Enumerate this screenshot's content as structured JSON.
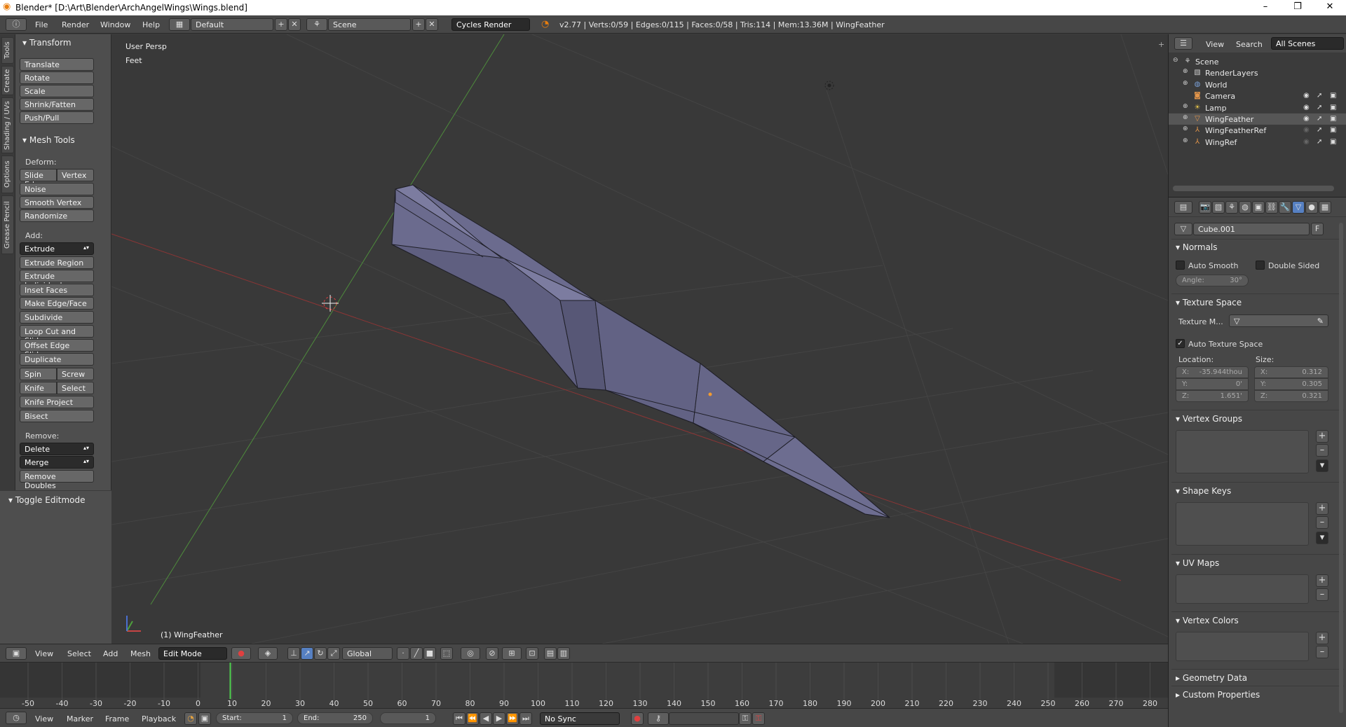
{
  "title_bar": {
    "title": "Blender* [D:\\Art\\Blender\\ArchAngelWings\\Wings.blend]",
    "minimize": "–",
    "maximize": "❐",
    "close": "✕"
  },
  "top_menu": {
    "items": [
      "File",
      "Render",
      "Window",
      "Help"
    ],
    "layout": "Default",
    "scene": "Scene",
    "engine": "Cycles Render",
    "stats": "v2.77 | Verts:0/59 | Edges:0/115 | Faces:0/58 | Tris:114 | Mem:13.36M | WingFeather"
  },
  "tool_tabs": [
    "Tools",
    "Create",
    "Shading / UVs",
    "Options",
    "Grease Pencil"
  ],
  "toolshelf": {
    "transform_header": "Transform",
    "transform": [
      "Translate",
      "Rotate",
      "Scale",
      "Shrink/Fatten",
      "Push/Pull"
    ],
    "mesh_tools_header": "Mesh Tools",
    "deform_label": "Deform:",
    "slide_edge": "Slide Ed",
    "vertex": "Vertex",
    "deform": [
      "Noise",
      "Smooth Vertex",
      "Randomize"
    ],
    "add_label": "Add:",
    "extrude": "Extrude",
    "add": [
      "Extrude Region",
      "Extrude Individual",
      "Inset Faces",
      "Make Edge/Face",
      "Subdivide",
      "Loop Cut and Slide",
      "Offset Edge Slide",
      "Duplicate"
    ],
    "spin": "Spin",
    "screw": "Screw",
    "knife": "Knife",
    "select": "Select",
    "add2": [
      "Knife Project",
      "Bisect"
    ],
    "remove_label": "Remove:",
    "delete": "Delete",
    "merge": "Merge",
    "remove_doubles": "Remove Doubles",
    "toggle_editmode": "Toggle Editmode"
  },
  "viewport": {
    "view_name": "User Persp",
    "units": "Feet",
    "object_label": "(1) WingFeather"
  },
  "view3d_header": {
    "menus": [
      "View",
      "Select",
      "Add",
      "Mesh"
    ],
    "mode": "Edit Mode",
    "orientation": "Global"
  },
  "timeline": {
    "ticks": [
      "-50",
      "-40",
      "-30",
      "-20",
      "-10",
      "0",
      "10",
      "20",
      "30",
      "40",
      "50",
      "60",
      "70",
      "80",
      "90",
      "100",
      "110",
      "120",
      "130",
      "140",
      "150",
      "160",
      "170",
      "180",
      "190",
      "200",
      "210",
      "220",
      "230",
      "240",
      "250",
      "260",
      "270",
      "280"
    ],
    "current_frame": 0
  },
  "timeline_header": {
    "menus": [
      "View",
      "Marker",
      "Frame",
      "Playback"
    ],
    "start_label": "Start:",
    "start": "1",
    "end_label": "End:",
    "end": "250",
    "frame": "1",
    "sync": "No Sync"
  },
  "outliner": {
    "menus": [
      "View",
      "Search"
    ],
    "filter": "All Scenes",
    "items": [
      {
        "name": "Scene",
        "icon": "scene-icon",
        "color": "#c9c9c9"
      },
      {
        "name": "RenderLayers",
        "icon": "render-layers-icon",
        "color": "#c9c9c9"
      },
      {
        "name": "World",
        "icon": "world-icon",
        "color": "#7aa0d8"
      },
      {
        "name": "Camera",
        "icon": "camera-icon",
        "color": "#e3954a"
      },
      {
        "name": "Lamp",
        "icon": "lamp-icon",
        "color": "#e3c14a"
      },
      {
        "name": "WingFeather",
        "icon": "mesh-icon",
        "color": "#e3954a",
        "selected": true
      },
      {
        "name": "WingFeatherRef",
        "icon": "empty-icon",
        "color": "#e3954a"
      },
      {
        "name": "WingRef",
        "icon": "empty-icon",
        "color": "#e3954a"
      }
    ]
  },
  "properties": {
    "mesh_name": "Cube.001",
    "fake_user": "F",
    "normals": "Normals",
    "auto_smooth": "Auto Smooth",
    "double_sided": "Double Sided",
    "angle": "Angle:",
    "angle_value": "30°",
    "texture_space": "Texture Space",
    "texture_mesh": "Texture M...",
    "auto_texture_space": "Auto Texture Space",
    "location_label": "Location:",
    "size_label": "Size:",
    "loc_x": "X:",
    "loc_x_value": "-35.944thou",
    "loc_y": "Y:",
    "loc_y_value": "0'",
    "loc_z": "Z:",
    "loc_z_value": "1.651'",
    "size_x": "X:",
    "size_x_value": "0.312",
    "size_y": "Y:",
    "size_y_value": "0.305",
    "size_z": "Z:",
    "size_z_value": "0.321",
    "vertex_groups": "Vertex Groups",
    "shape_keys": "Shape Keys",
    "uv_maps": "UV Maps",
    "vertex_colors": "Vertex Colors",
    "geometry_data": "Geometry Data",
    "custom_properties": "Custom Properties"
  }
}
